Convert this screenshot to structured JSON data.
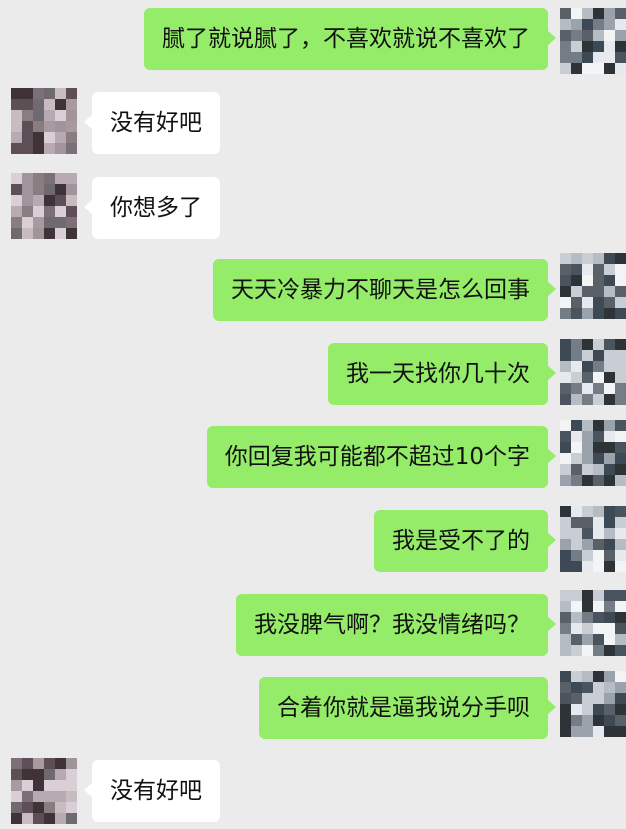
{
  "conversation": {
    "messages": [
      {
        "sender": "me",
        "text": "腻了就说腻了，不喜欢就说不喜欢了"
      },
      {
        "sender": "them",
        "text": "没有好吧"
      },
      {
        "sender": "them",
        "text": "你想多了"
      },
      {
        "sender": "me",
        "text": "天天冷暴力不聊天是怎么回事"
      },
      {
        "sender": "me",
        "text": "我一天找你几十次"
      },
      {
        "sender": "me",
        "text": "你回复我可能都不超过10个字"
      },
      {
        "sender": "me",
        "text": "我是受不了的"
      },
      {
        "sender": "me",
        "text": "我没脾气啊？我没情绪吗？"
      },
      {
        "sender": "me",
        "text": "合着你就是逼我说分手呗"
      },
      {
        "sender": "them",
        "text": "没有好吧"
      }
    ]
  },
  "colors": {
    "background": "#ebebeb",
    "my_bubble": "#95ec69",
    "their_bubble": "#ffffff"
  },
  "icons": {
    "my_avatar": "pixelated-avatar-icon",
    "their_avatar": "pixelated-avatar-icon"
  }
}
